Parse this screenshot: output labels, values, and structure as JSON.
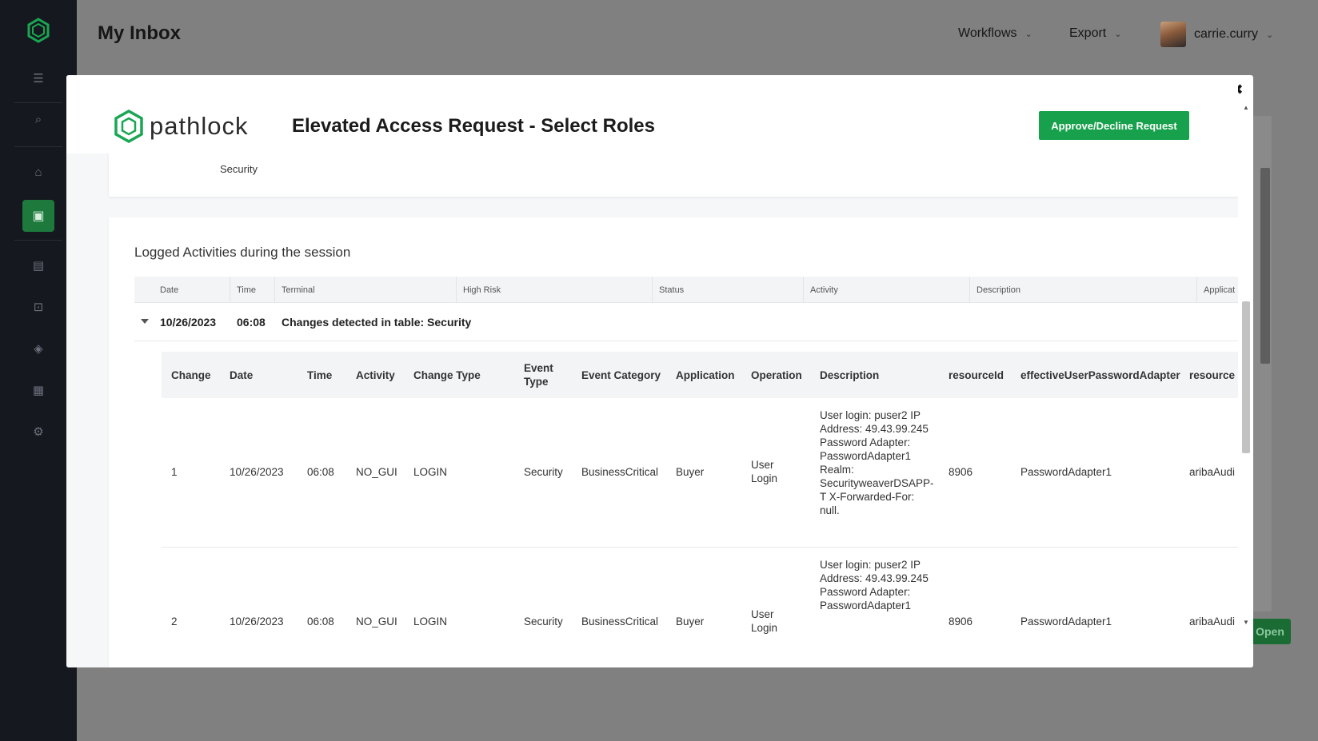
{
  "app": {
    "page_title": "My Inbox",
    "nav": {
      "workflows": "Workflows",
      "export": "Export",
      "username": "carrie.curry"
    },
    "bg_open_label": "Open"
  },
  "modal": {
    "brand": "pathlock",
    "title": "Elevated Access Request - Select Roles",
    "approve_button": "Approve/Decline Request",
    "top_card_label": "Security",
    "log_section": {
      "title": "Logged Activities during the session",
      "outer_columns": [
        "Date",
        "Time",
        "Terminal",
        "High Risk",
        "Status",
        "Activity",
        "Description",
        "Applicat"
      ],
      "group": {
        "date": "10/26/2023",
        "time": "06:08",
        "label": "Changes detected in table: Security"
      },
      "inner_columns": [
        "Change",
        "Date",
        "Time",
        "Activity",
        "Change Type",
        "Event Type",
        "Event Category",
        "Application",
        "Operation",
        "Description",
        "resourceId",
        "effectiveUserPasswordAdapter",
        "resource"
      ],
      "rows": [
        {
          "change": "1",
          "date": "10/26/2023",
          "time": "06:08",
          "activity": "NO_GUI",
          "change_type": "LOGIN",
          "event_type": "Security",
          "event_category": "BusinessCritical",
          "application": "Buyer",
          "operation": "User Login",
          "description": "User login: puser2 IP Address: 49.43.99.245 Password Adapter: PasswordAdapter1 Realm: SecurityweaverDSAPP-T X-Forwarded-For: null.",
          "resource_id": "8906",
          "adapter": "PasswordAdapter1",
          "resource": "aribaAudi"
        },
        {
          "change": "2",
          "date": "10/26/2023",
          "time": "06:08",
          "activity": "NO_GUI",
          "change_type": "LOGIN",
          "event_type": "Security",
          "event_category": "BusinessCritical",
          "application": "Buyer",
          "operation": "User Login",
          "description": "User login: puser2 IP Address: 49.43.99.245 Password Adapter: PasswordAdapter1",
          "resource_id": "8906",
          "adapter": "PasswordAdapter1",
          "resource": "aribaAudi"
        }
      ]
    }
  },
  "colors": {
    "sidebar_bg": "#16181f",
    "accent_green": "#18a14c",
    "sidebar_active": "#1d7a3c",
    "overlay_bg": "#808080"
  }
}
